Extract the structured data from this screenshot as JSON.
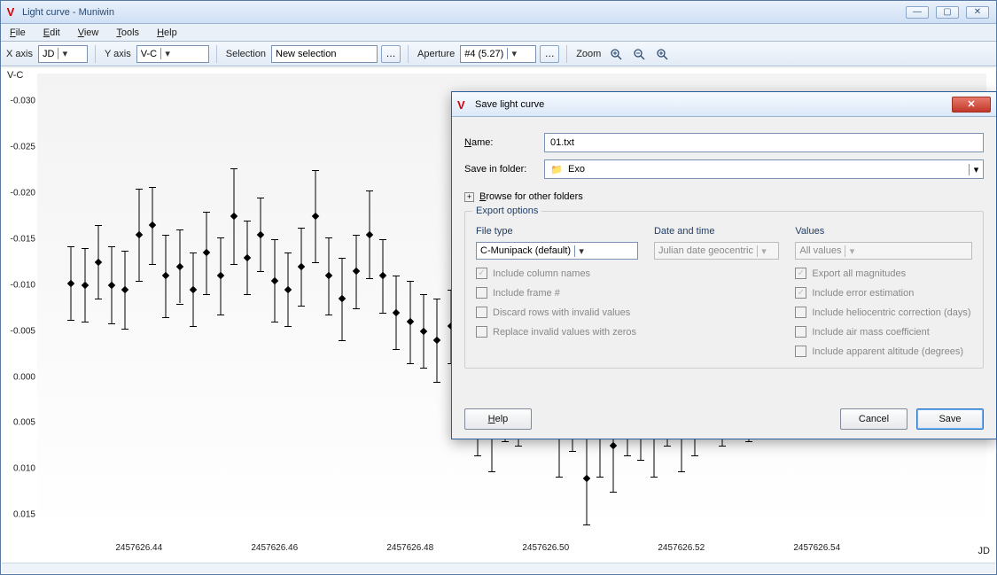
{
  "window": {
    "title": "Light curve - Muniwin"
  },
  "menu": {
    "file": "File",
    "edit": "Edit",
    "view": "View",
    "tools": "Tools",
    "help": "Help"
  },
  "toolbar": {
    "xaxis_label": "X axis",
    "xaxis_value": "JD",
    "yaxis_label": "Y axis",
    "yaxis_value": "V-C",
    "selection_label": "Selection",
    "selection_value": "New selection",
    "aperture_label": "Aperture",
    "aperture_value": "#4 (5.27)",
    "zoom_label": "Zoom"
  },
  "chart_data": {
    "type": "scatter",
    "title": "",
    "xlabel": "JD",
    "ylabel": "V-C",
    "xlim": [
      2457626.425,
      2457626.565
    ],
    "ylim": [
      0.017,
      -0.033
    ],
    "yticks": [
      -0.03,
      -0.025,
      -0.02,
      -0.015,
      -0.01,
      -0.005,
      0.0,
      0.005,
      0.01,
      0.015
    ],
    "xticks": [
      2457626.44,
      2457626.46,
      2457626.48,
      2457626.5,
      2457626.52,
      2457626.54
    ],
    "points": [
      {
        "x": 2457626.43,
        "y": -0.0102,
        "e": 0.004
      },
      {
        "x": 2457626.432,
        "y": -0.01,
        "e": 0.004
      },
      {
        "x": 2457626.434,
        "y": -0.0125,
        "e": 0.004
      },
      {
        "x": 2457626.436,
        "y": -0.01,
        "e": 0.0042
      },
      {
        "x": 2457626.438,
        "y": -0.0095,
        "e": 0.0042
      },
      {
        "x": 2457626.44,
        "y": -0.0155,
        "e": 0.005
      },
      {
        "x": 2457626.442,
        "y": -0.0165,
        "e": 0.0042
      },
      {
        "x": 2457626.444,
        "y": -0.011,
        "e": 0.0045
      },
      {
        "x": 2457626.446,
        "y": -0.012,
        "e": 0.004
      },
      {
        "x": 2457626.448,
        "y": -0.0095,
        "e": 0.004
      },
      {
        "x": 2457626.45,
        "y": -0.0135,
        "e": 0.0045
      },
      {
        "x": 2457626.452,
        "y": -0.011,
        "e": 0.0042
      },
      {
        "x": 2457626.454,
        "y": -0.0175,
        "e": 0.0052
      },
      {
        "x": 2457626.456,
        "y": -0.013,
        "e": 0.004
      },
      {
        "x": 2457626.458,
        "y": -0.0155,
        "e": 0.004
      },
      {
        "x": 2457626.46,
        "y": -0.0105,
        "e": 0.0045
      },
      {
        "x": 2457626.462,
        "y": -0.0095,
        "e": 0.004
      },
      {
        "x": 2457626.464,
        "y": -0.012,
        "e": 0.0042
      },
      {
        "x": 2457626.466,
        "y": -0.0175,
        "e": 0.005
      },
      {
        "x": 2457626.468,
        "y": -0.011,
        "e": 0.0042
      },
      {
        "x": 2457626.47,
        "y": -0.0085,
        "e": 0.0045
      },
      {
        "x": 2457626.472,
        "y": -0.0115,
        "e": 0.004
      },
      {
        "x": 2457626.474,
        "y": -0.0155,
        "e": 0.0048
      },
      {
        "x": 2457626.476,
        "y": -0.011,
        "e": 0.004
      },
      {
        "x": 2457626.478,
        "y": -0.007,
        "e": 0.004
      },
      {
        "x": 2457626.48,
        "y": -0.006,
        "e": 0.0045
      },
      {
        "x": 2457626.482,
        "y": -0.005,
        "e": 0.004
      },
      {
        "x": 2457626.484,
        "y": -0.004,
        "e": 0.0045
      },
      {
        "x": 2457626.486,
        "y": -0.0055,
        "e": 0.004
      },
      {
        "x": 2457626.488,
        "y": -0.0032,
        "e": 0.0048
      },
      {
        "x": 2457626.49,
        "y": 0.004,
        "e": 0.0045
      },
      {
        "x": 2457626.492,
        "y": 0.0055,
        "e": 0.0048
      },
      {
        "x": 2457626.494,
        "y": 0.0022,
        "e": 0.0048
      },
      {
        "x": 2457626.496,
        "y": 0.003,
        "e": 0.0045
      },
      {
        "x": 2457626.498,
        "y": 0.0005,
        "e": 0.0045
      },
      {
        "x": 2457626.5,
        "y": 0.0015,
        "e": 0.0048
      },
      {
        "x": 2457626.502,
        "y": 0.006,
        "e": 0.0048
      },
      {
        "x": 2457626.504,
        "y": 0.0035,
        "e": 0.0045
      },
      {
        "x": 2457626.506,
        "y": 0.011,
        "e": 0.005
      },
      {
        "x": 2457626.508,
        "y": 0.006,
        "e": 0.0048
      },
      {
        "x": 2457626.51,
        "y": 0.0075,
        "e": 0.005
      },
      {
        "x": 2457626.512,
        "y": 0.004,
        "e": 0.0045
      },
      {
        "x": 2457626.514,
        "y": 0.0045,
        "e": 0.0045
      },
      {
        "x": 2457626.516,
        "y": 0.006,
        "e": 0.0048
      },
      {
        "x": 2457626.518,
        "y": 0.003,
        "e": 0.0045
      },
      {
        "x": 2457626.52,
        "y": 0.0055,
        "e": 0.0048
      },
      {
        "x": 2457626.522,
        "y": 0.004,
        "e": 0.0045
      },
      {
        "x": 2457626.524,
        "y": 0.002,
        "e": 0.0045
      },
      {
        "x": 2457626.526,
        "y": 0.003,
        "e": 0.0045
      },
      {
        "x": 2457626.53,
        "y": 0.0025,
        "e": 0.0045
      }
    ]
  },
  "dialog": {
    "title": "Save light curve",
    "name_label": "Name:",
    "name_value": "01.txt",
    "folder_label": "Save in folder:",
    "folder_value": "Exo",
    "browse": "Browse for other folders",
    "group": "Export options",
    "col_filetype": "File type",
    "filetype_value": "C-Munipack (default)",
    "col_datetime": "Date and time",
    "datetime_value": "Julian date geocentric",
    "col_values": "Values",
    "values_value": "All values",
    "chk_colnames": "Include column names",
    "chk_frame": "Include frame #",
    "chk_discard": "Discard rows with invalid values",
    "chk_replace": "Replace invalid values with zeros",
    "chk_expall": "Export all magnitudes",
    "chk_err": "Include error estimation",
    "chk_helio": "Include heliocentric correction (days)",
    "chk_airmass": "Include air mass coefficient",
    "chk_appalt": "Include apparent altitude (degrees)",
    "btn_help": "Help",
    "btn_cancel": "Cancel",
    "btn_save": "Save"
  }
}
